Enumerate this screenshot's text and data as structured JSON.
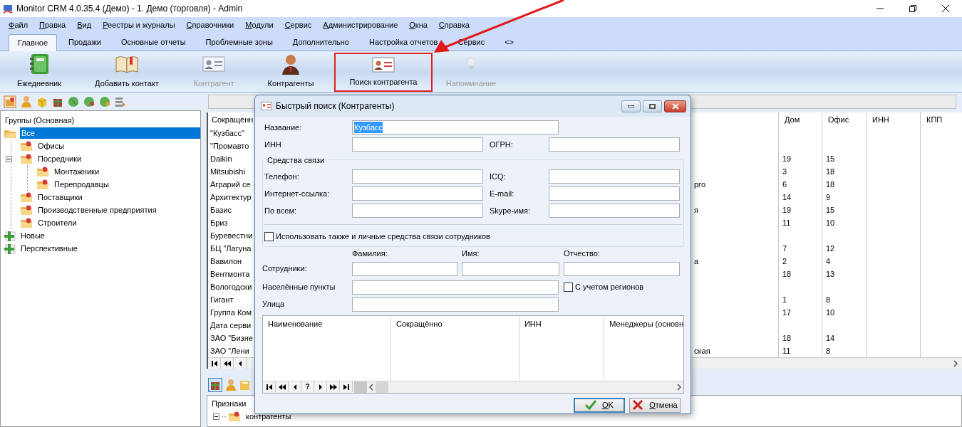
{
  "window": {
    "title": "Monitor CRM 4.0.35.4 (Демо) - 1. Демо (торговля) - Admin"
  },
  "menu": [
    "Файл",
    "Правка",
    "Вид",
    "Реестры и журналы",
    "Справочники",
    "Модули",
    "Сервис",
    "Администрирование",
    "Окна",
    "Справка"
  ],
  "tabs": [
    {
      "label": "Главное",
      "selected": true
    },
    {
      "label": "Продажи",
      "selected": false
    },
    {
      "label": "Основные отчеты",
      "selected": false
    },
    {
      "label": "Проблемные зоны",
      "selected": false
    },
    {
      "label": "Дополнительно",
      "selected": false
    },
    {
      "label": "Настройка отчетов",
      "selected": false
    },
    {
      "label": "Сервис",
      "selected": false
    },
    {
      "label": "<>",
      "selected": false
    }
  ],
  "ribbon": [
    {
      "label": "Ежедневник",
      "kind": "diary",
      "disabled": false,
      "highlighted": false
    },
    {
      "label": "Добавить контакт",
      "kind": "book",
      "disabled": false,
      "highlighted": false
    },
    {
      "label": "Контрагент",
      "kind": "card",
      "disabled": true,
      "highlighted": false
    },
    {
      "label": "Контрагенты",
      "kind": "person",
      "disabled": false,
      "highlighted": false
    },
    {
      "label": "Поиск контрагента",
      "kind": "search-card",
      "disabled": false,
      "highlighted": true
    },
    {
      "label": "Напоминание",
      "kind": "bulb",
      "disabled": true,
      "highlighted": false
    }
  ],
  "groups": {
    "title": "Группы (Основная)",
    "items": [
      {
        "label": "Все",
        "kind": "root",
        "selected": true,
        "children": [
          {
            "label": "Офисы",
            "kind": "group",
            "selected": false
          },
          {
            "label": "Посредники",
            "kind": "group",
            "selected": false,
            "expanded": true,
            "children": [
              {
                "label": "Монтажники",
                "kind": "group",
                "selected": false
              },
              {
                "label": "Перепродавцы",
                "kind": "group",
                "selected": false
              }
            ]
          },
          {
            "label": "Поставщики",
            "kind": "group",
            "selected": false
          },
          {
            "label": "Производственные предприятия",
            "kind": "group",
            "selected": false
          },
          {
            "label": "Строители",
            "kind": "group",
            "selected": false
          }
        ]
      },
      {
        "label": "Новые",
        "kind": "status",
        "selected": false
      },
      {
        "label": "Перспективные",
        "kind": "status",
        "selected": false
      }
    ]
  },
  "contacts_table": {
    "columns": {
      "name": "Сокращенн",
      "house": "Дом",
      "office": "Офис",
      "inn": "ИНН",
      "kpp": "КПП"
    },
    "rows": [
      {
        "name": "\"Кузбасс\""
      },
      {
        "name": "\"Промавто"
      },
      {
        "name": "Daikin",
        "house": "19",
        "office": "15"
      },
      {
        "name": "Mitsubishi",
        "house": "3",
        "office": "18"
      },
      {
        "name": "Аграрий се",
        "column_2": "рго",
        "house": "6",
        "office": "18"
      },
      {
        "name": "Архитектур",
        "house": "14",
        "office": "9"
      },
      {
        "name": "Базис",
        "column_2": "я",
        "house": "19",
        "office": "15"
      },
      {
        "name": "Бриз",
        "house": "11",
        "office": "10"
      },
      {
        "name": "Буревестни"
      },
      {
        "name": "БЦ \"Лагуна",
        "house": "7",
        "office": "12"
      },
      {
        "name": "Вавилон",
        "column_2": "а",
        "house": "2",
        "office": "4"
      },
      {
        "name": "Вентмонта",
        "house": "18",
        "office": "13"
      },
      {
        "name": "Вологодски"
      },
      {
        "name": "Гигант",
        "house": "1",
        "office": "8"
      },
      {
        "name": "Группа Ком",
        "house": "17",
        "office": "10"
      },
      {
        "name": "Дата серви"
      },
      {
        "name": "ЗАО \"Бизне",
        "house": "18",
        "office": "14"
      },
      {
        "name": "ЗАО \"Лени",
        "column_2": "ская",
        "house": "11",
        "office": "8"
      }
    ]
  },
  "bottom_panel": {
    "title": "Признаки",
    "tree": [
      {
        "label": "контрагенты",
        "expanded": true
      }
    ]
  },
  "dialog": {
    "title": "Быстрый поиск (Контрагенты)",
    "name_field": {
      "label": "Название:",
      "value": "Кузбасс",
      "value_selected": true
    },
    "inn_field": {
      "label": "ИНН"
    },
    "ogrn_field": {
      "label": "ОГРН:"
    },
    "contacts_group": {
      "title": "Средства связи",
      "fields": [
        {
          "label": "Телефон:"
        },
        {
          "label": "ICQ:"
        },
        {
          "label": "Интернет-ссылка:"
        },
        {
          "label": "E-mail:"
        },
        {
          "label": "По всем:"
        },
        {
          "label": "Skype-имя:"
        }
      ]
    },
    "use_personal": {
      "label": "Использовать также и личные средства связи сотрудников",
      "checked": false
    },
    "employees": {
      "label": "Сотрудники:",
      "fields": [
        "Фамилия:",
        "Имя:",
        "Отчество:"
      ]
    },
    "localities": {
      "label": "Населённые пункты"
    },
    "with_regions": {
      "label": "С учетом регионов",
      "checked": false
    },
    "street": {
      "label": "Улица"
    },
    "results": {
      "columns": [
        "Наименование",
        "Сокращённо",
        "ИНН",
        "Менеджеры (основн"
      ],
      "nav_help": "?"
    },
    "buttons": [
      {
        "label": "OK",
        "kind": "ok",
        "default": true
      },
      {
        "label": "Отмена",
        "kind": "cancel",
        "default": false
      }
    ]
  }
}
